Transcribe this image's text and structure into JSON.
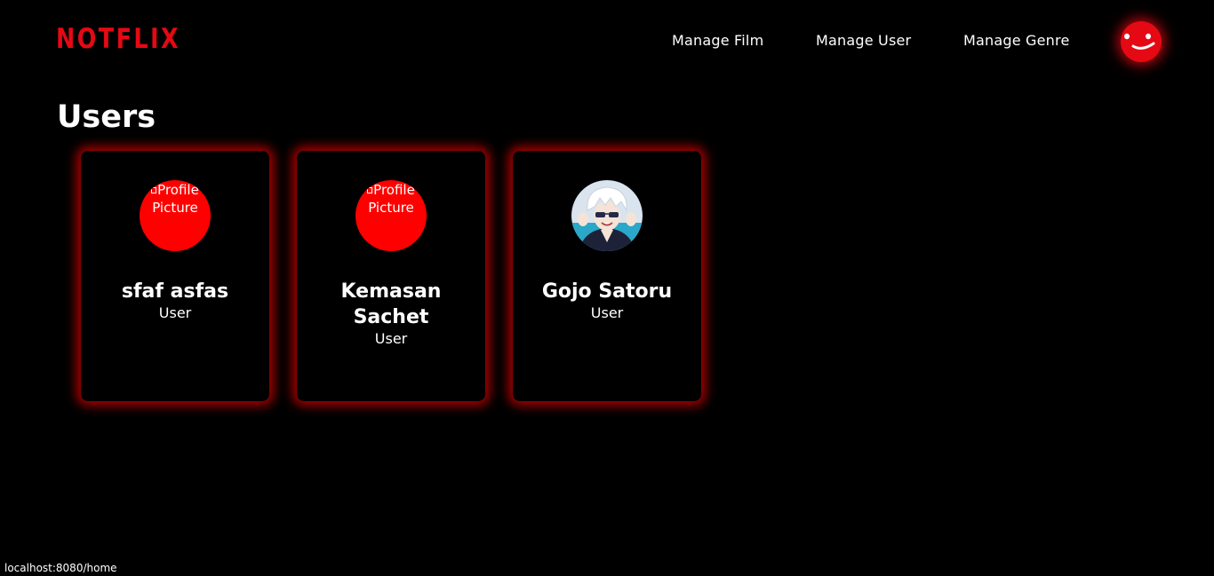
{
  "brand": {
    "logo_text": "NOTFLIX",
    "accent_color": "#e50914"
  },
  "nav": {
    "items": [
      {
        "label": "Manage Film"
      },
      {
        "label": "Manage User"
      },
      {
        "label": "Manage Genre"
      }
    ],
    "profile_icon": "smiley-face-icon"
  },
  "page": {
    "title": "Users"
  },
  "users": [
    {
      "name": "sfaf asfas",
      "role": "User",
      "avatar_alt": "Profile Picture",
      "avatar": "broken-image"
    },
    {
      "name": "Kemasan Sachet",
      "role": "User",
      "avatar_alt": "Profile Picture",
      "avatar": "broken-image"
    },
    {
      "name": "Gojo Satoru",
      "role": "User",
      "avatar": "anime-character-photo"
    }
  ],
  "status_bar": {
    "url": "localhost:8080/home"
  }
}
